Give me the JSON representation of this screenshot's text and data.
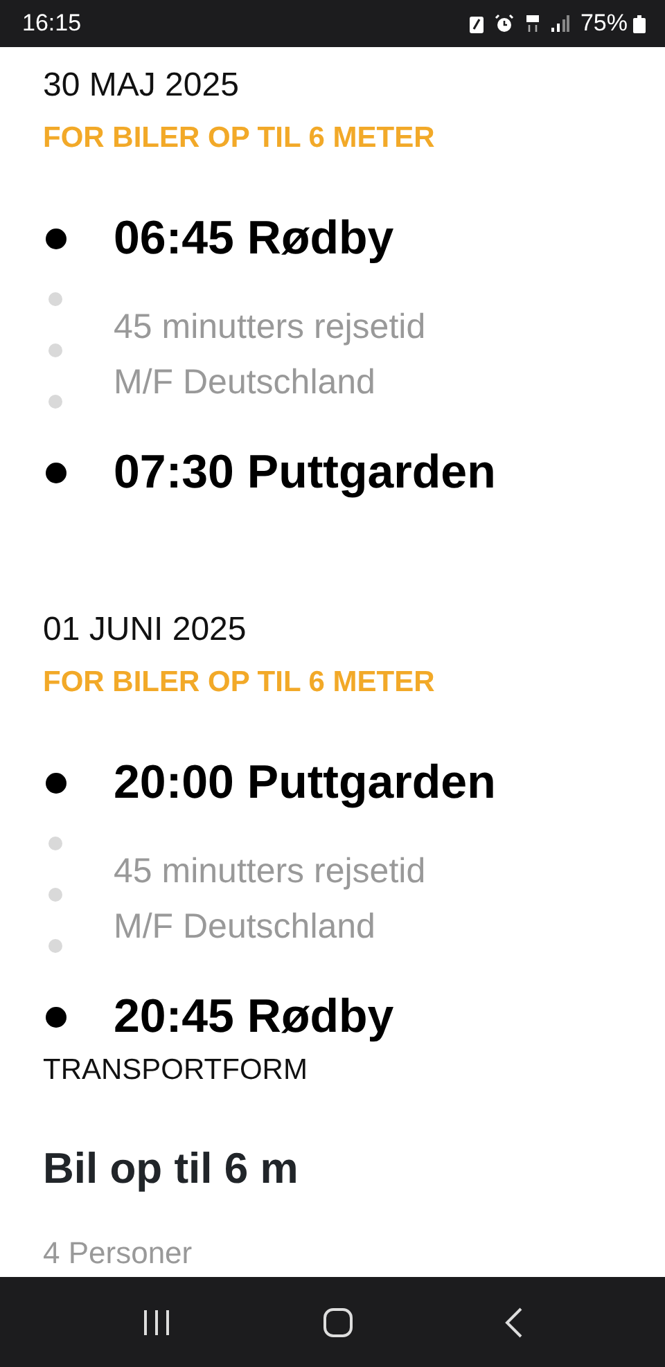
{
  "status_bar": {
    "time": "16:15",
    "battery": "75%"
  },
  "trips": [
    {
      "date": "30 MAJ 2025",
      "subtitle": "FOR BILER OP TIL 6 METER",
      "departure": "06:45 Rødby",
      "details": [
        "45 minutters rejsetid",
        "M/F Deutschland"
      ],
      "arrival": "07:30 Puttgarden"
    },
    {
      "date": "01 JUNI 2025",
      "subtitle": "FOR BILER OP TIL 6 METER",
      "departure": "20:00 Puttgarden",
      "details": [
        "45 minutters rejsetid",
        "M/F Deutschland"
      ],
      "arrival": "20:45 Rødby"
    }
  ],
  "transport": {
    "heading": "TRANSPORTFORM",
    "vehicle": "Bil op til 6 m",
    "passengers": "4 Personer"
  }
}
